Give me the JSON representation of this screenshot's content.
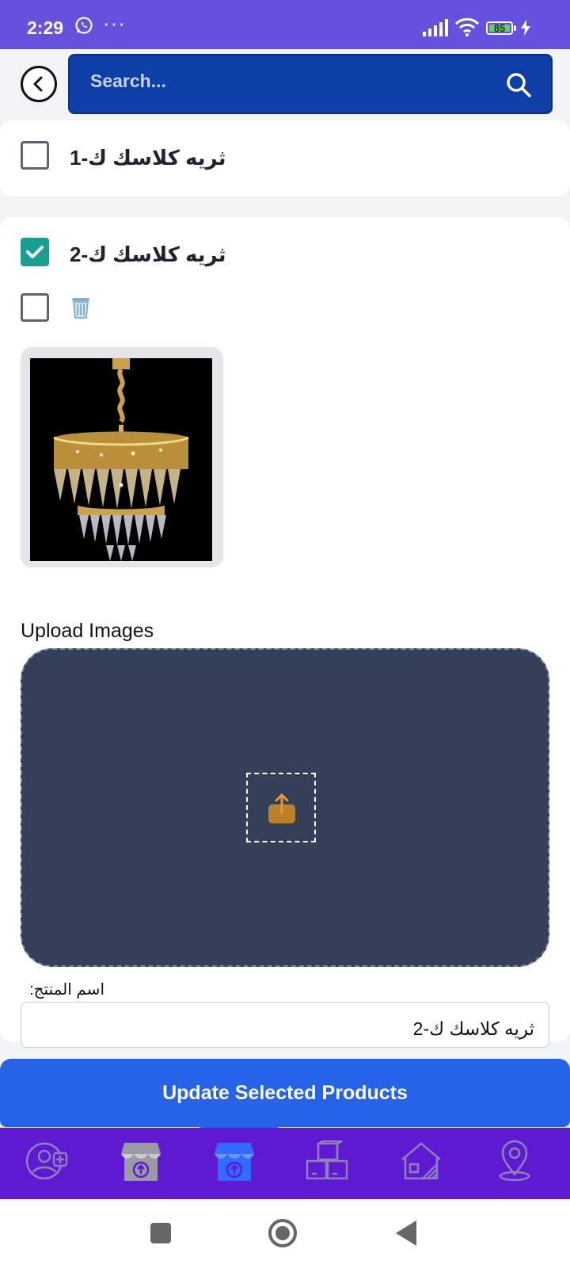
{
  "status_bar": {
    "time": "2:29",
    "more": "···",
    "battery": "85"
  },
  "header": {
    "search_placeholder": "Search..."
  },
  "products": [
    {
      "title": "ثريه كلاسك ك-1",
      "checked": false
    },
    {
      "title": "ثريه كلاسك ك-2",
      "checked": true
    }
  ],
  "editor": {
    "image_checkbox_checked": false,
    "upload_label": "Upload Images",
    "name_label": "اسم المنتج:",
    "name_value": "ثريه كلاسك ك-2"
  },
  "actions": {
    "update_label": "Update Selected Products"
  },
  "bottom_nav": {
    "items": [
      "add-user-icon",
      "store-upload-icon",
      "store-upload-active-icon",
      "boxes-icon",
      "property-icon",
      "location-pin-icon"
    ],
    "active_index": 2
  },
  "colors": {
    "status_bar": "#6650de",
    "search_bg": "#0d3fa6",
    "checkbox_checked": "#17a092",
    "upload_zone": "#344058",
    "upload_icon": "#b9812a",
    "update_button": "#2563e8",
    "bottom_nav": "#5d1ad0",
    "nav_active": "#2f6bff",
    "nav_inactive": "#8e82b8"
  }
}
